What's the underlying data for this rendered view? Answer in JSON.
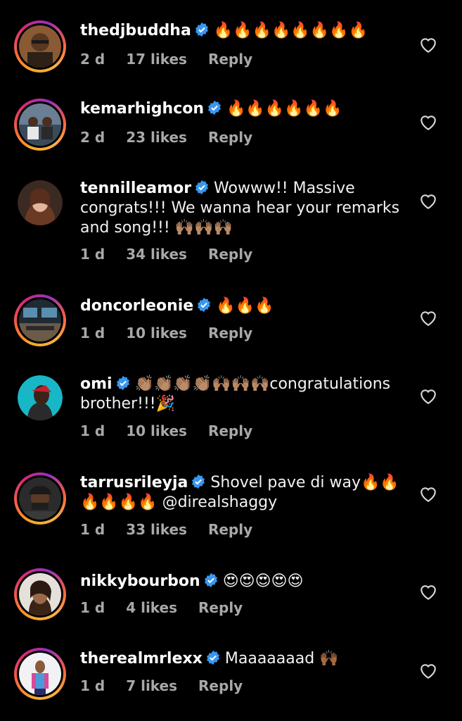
{
  "comments": [
    {
      "username": "thedjbuddha",
      "text": "🔥🔥🔥🔥🔥🔥🔥🔥",
      "time": "2 d",
      "likes": "17 likes",
      "reply": "Reply"
    },
    {
      "username": "kemarhighcon",
      "text": "🔥🔥🔥🔥🔥🔥",
      "time": "2 d",
      "likes": "23 likes",
      "reply": "Reply"
    },
    {
      "username": "tennilleamor",
      "text": "Wowww!! Massive congrats!!! We wanna hear your remarks and song!!! 🙌🏽🙌🏽🙌🏽",
      "time": "1 d",
      "likes": "34 likes",
      "reply": "Reply"
    },
    {
      "username": "doncorleonie",
      "text": "🔥🔥🔥",
      "time": "1 d",
      "likes": "10 likes",
      "reply": "Reply"
    },
    {
      "username": "omi",
      "text": "👏🏽👏🏽👏🏽👏🏽🙌🏽🙌🏽🙌🏽congratulations brother!!!🎉",
      "time": "1 d",
      "likes": "10 likes",
      "reply": "Reply"
    },
    {
      "username": "tarrusrileyja",
      "text": "Shovel pave di way🔥🔥🔥🔥🔥🔥 @direalshaggy",
      "time": "1 d",
      "likes": "33 likes",
      "reply": "Reply"
    },
    {
      "username": "nikkybourbon",
      "text": "😍😍😍😍😍",
      "time": "1 d",
      "likes": "4 likes",
      "reply": "Reply"
    },
    {
      "username": "therealmrlexx",
      "text": "Maaaaaaad 🙌🏾",
      "time": "1 d",
      "likes": "7 likes",
      "reply": "Reply"
    }
  ],
  "icons": {
    "verified": "verified-badge-icon",
    "like": "heart-outline-icon"
  },
  "colors": {
    "verified": "#3897f0",
    "muted": "#a8a8a8",
    "background": "#000000"
  }
}
